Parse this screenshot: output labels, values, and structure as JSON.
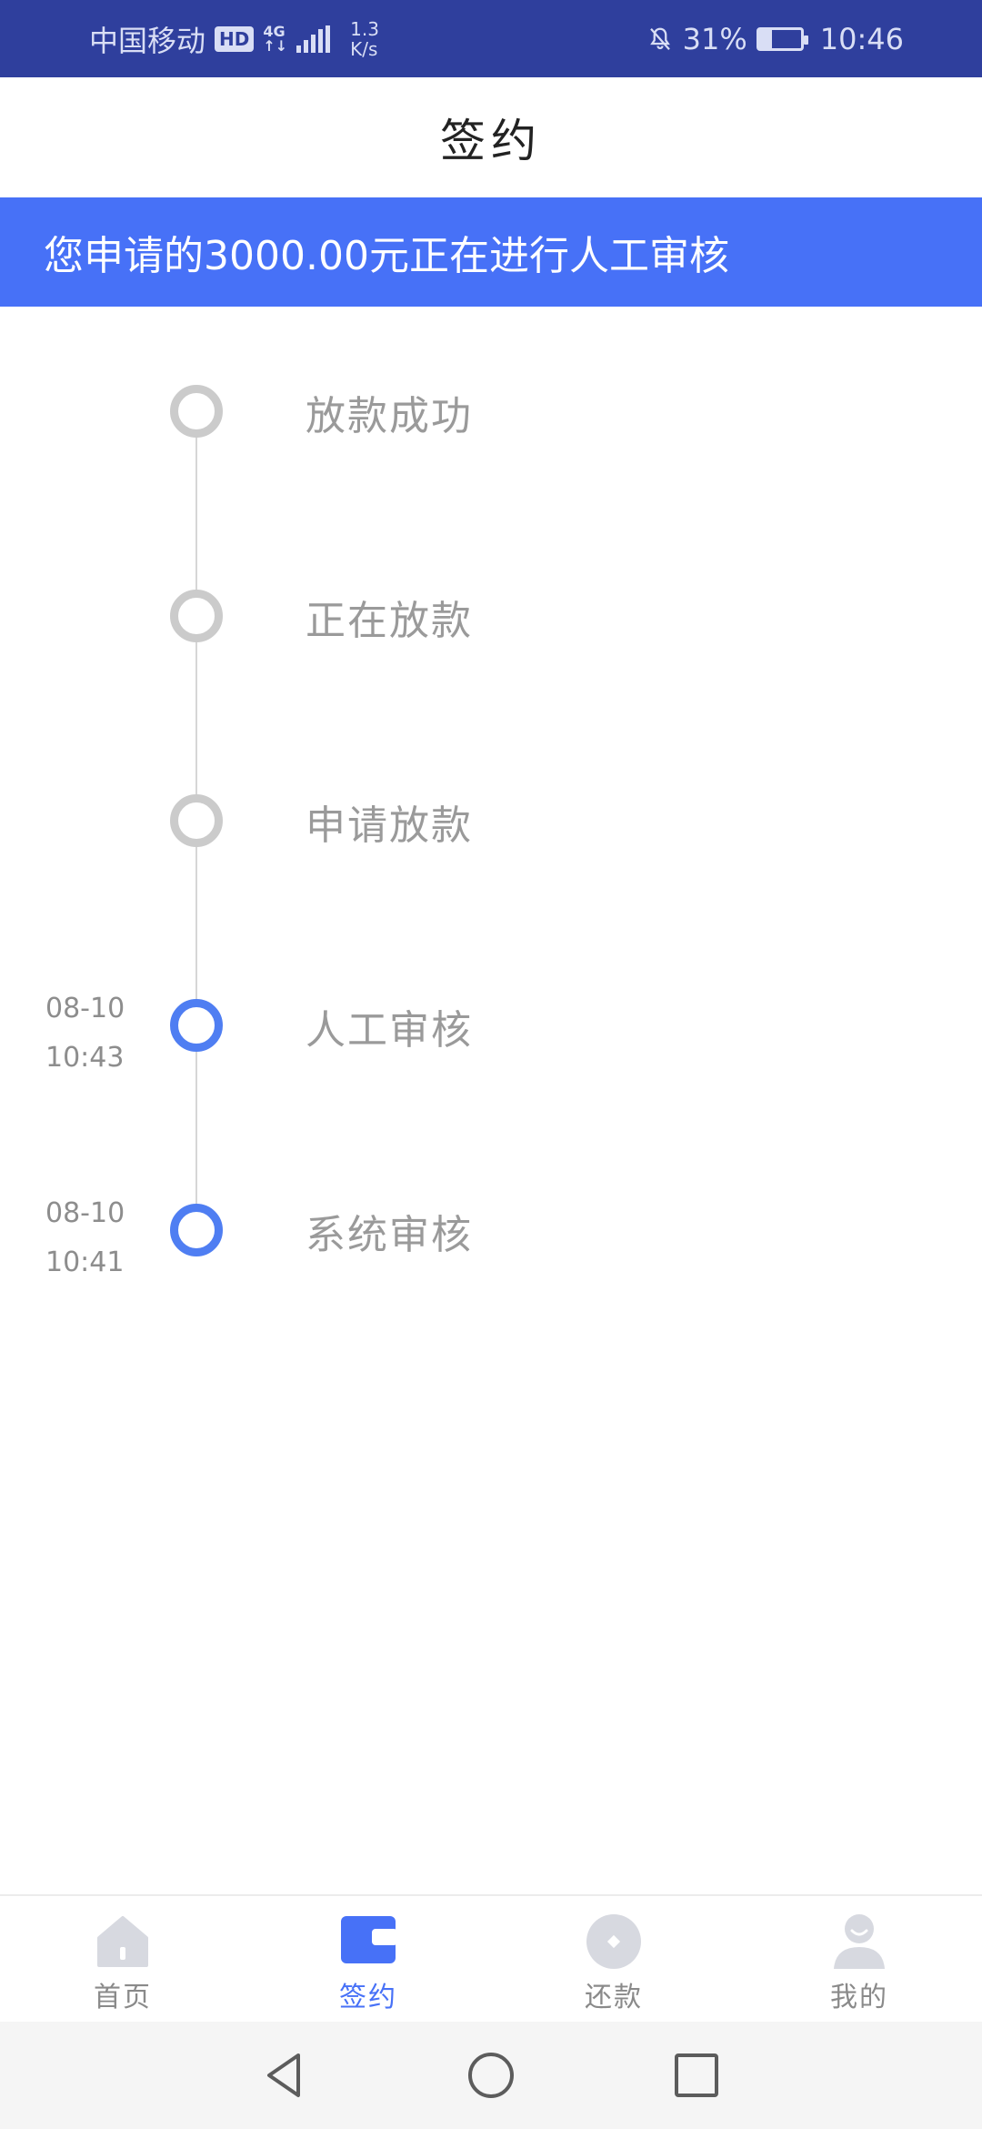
{
  "status_bar": {
    "carrier": "中国移动",
    "hd": "HD",
    "net_type_top": "4G",
    "net_type_bottom": "↑↓",
    "speed_value": "1.3",
    "speed_unit": "K/s",
    "battery_percent": "31%",
    "battery_level": 0.31,
    "time": "10:46"
  },
  "header": {
    "title": "签约"
  },
  "banner": {
    "message": "您申请的3000.00元正在进行人工审核"
  },
  "timeline": {
    "steps": [
      {
        "label": "放款成功",
        "date": "",
        "time": "",
        "status": "pending"
      },
      {
        "label": "正在放款",
        "date": "",
        "time": "",
        "status": "pending"
      },
      {
        "label": "申请放款",
        "date": "",
        "time": "",
        "status": "pending"
      },
      {
        "label": "人工审核",
        "date": "08-10",
        "time": "10:43",
        "status": "done"
      },
      {
        "label": "系统审核",
        "date": "08-10",
        "time": "10:41",
        "status": "done"
      }
    ]
  },
  "bottom_nav": {
    "items": [
      {
        "label": "首页",
        "icon": "home-icon",
        "active": false
      },
      {
        "label": "签约",
        "icon": "wallet-icon",
        "active": true
      },
      {
        "label": "还款",
        "icon": "coin-icon",
        "active": false
      },
      {
        "label": "我的",
        "icon": "user-icon",
        "active": false
      }
    ]
  },
  "colors": {
    "status_bar": "#2f3f9d",
    "accent": "#4771f7",
    "inactive_dot": "#cbcbcb",
    "active_dot": "#4f7ef2"
  }
}
